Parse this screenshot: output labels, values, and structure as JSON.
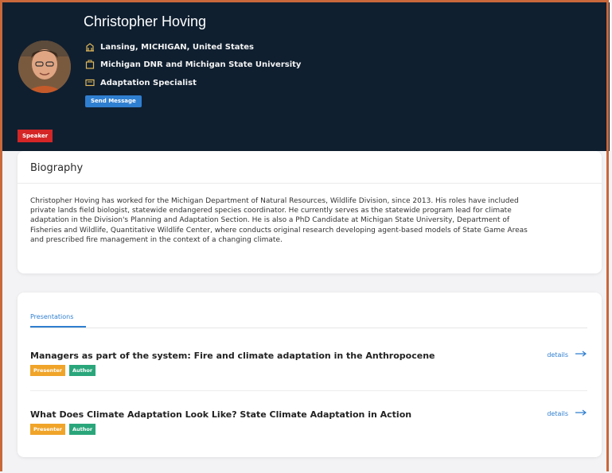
{
  "profile": {
    "name": "Christopher Hoving",
    "location": "Lansing, MICHIGAN, United States",
    "organization": "Michigan DNR and Michigan State University",
    "title": "Adaptation Specialist",
    "send_message_label": "Send Message",
    "role_badge": "Speaker"
  },
  "biography": {
    "heading": "Biography",
    "lines": [
      "Christopher Hoving has worked for the Michigan Department of Natural Resources, Wildlife Division, since 2013. His roles have included",
      "private lands field biologist, statewide endangered species coordinator. He currently serves as the statewide program lead for climate",
      "adaptation in the Division's Planning and Adaptation Section. He is also a PhD Candidate at Michigan State University, Department of",
      "Fisheries and Wildlife, Quantitative Wildlife Center, where conducts original research developing agent-based models of State Game Areas",
      "and prescribed fire management in the context of a changing climate."
    ]
  },
  "presentations": {
    "tab_label": "Presentations",
    "details_label": "details",
    "items": [
      {
        "title": "Managers as part of the system: Fire and climate adaptation in the Anthropocene",
        "tags": [
          "Presenter",
          "Author"
        ]
      },
      {
        "title": "What Does Climate Adaptation Look Like? State Climate Adaptation in Action",
        "tags": [
          "Presenter",
          "Author"
        ]
      }
    ]
  },
  "colors": {
    "header_bg": "#0f1f30",
    "accent": "#2f7fd0",
    "speaker_badge": "#d42626",
    "presenter_tag": "#f0a429",
    "author_tag": "#2aa67b"
  },
  "icons": {
    "location": "building-icon",
    "organization": "briefcase-icon",
    "title": "id-card-icon",
    "details": "arrow-right-icon"
  }
}
